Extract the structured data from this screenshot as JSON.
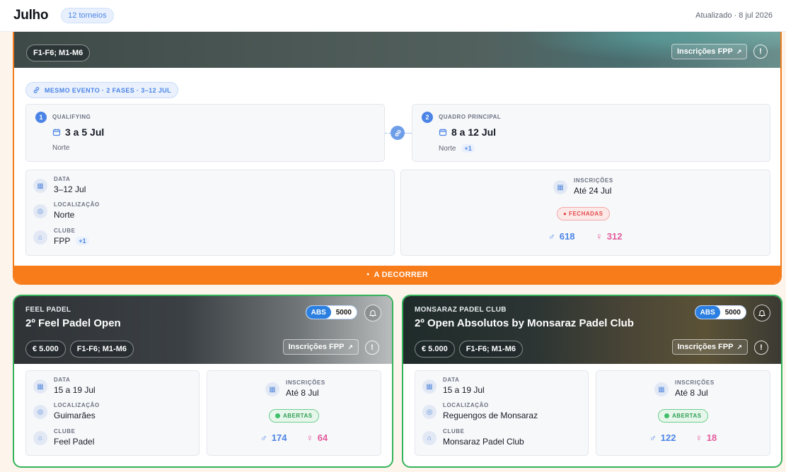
{
  "header": {
    "month": "Julho",
    "tournament_count": "12 torneios",
    "updated": "Atualizado · 8 jul 2026"
  },
  "featured": {
    "category": "F1-F6; M1-M6",
    "fpp_button": "Inscrições FPP",
    "info_icon": "!",
    "event_link": "MESMO EVENTO · 2 FASES · 3–12 JUL",
    "phases": [
      {
        "number": "1",
        "title": "QUALIFYING",
        "date": "3 a 5 Jul",
        "location": "Norte",
        "extra": ""
      },
      {
        "number": "2",
        "title": "QUADRO PRINCIPAL",
        "date": "8 a 12 Jul",
        "location": "Norte",
        "extra": "+1"
      }
    ],
    "details": {
      "date_label": "DATA",
      "date_value": "3–12 Jul",
      "location_label": "LOCALIZAÇÃO",
      "location_value": "Norte",
      "club_label": "CLUBE",
      "club_value": "FPP",
      "club_extra": "+1"
    },
    "registration": {
      "label": "INSCRIÇÕES",
      "value": "Até 24 Jul",
      "status": "FECHADAS",
      "male_count": "618",
      "female_count": "312"
    },
    "footer_status": "A DECORRER"
  },
  "cards": [
    {
      "club": "FEEL PADEL",
      "title": "2º Feel Padel Open",
      "level": "ABS",
      "points": "5000",
      "prize": "€ 5.000",
      "category": "F1-F6; M1-M6",
      "fpp_button": "Inscrições FPP",
      "info_icon": "!",
      "date_label": "DATA",
      "date_value": "15 a 19 Jul",
      "location_label": "LOCALIZAÇÃO",
      "location_value": "Guimarães",
      "club_label": "CLUBE",
      "club_value": "Feel Padel",
      "reg_label": "INSCRIÇÕES",
      "reg_value": "Até 8 Jul",
      "status": "ABERTAS",
      "male_count": "174",
      "female_count": "64"
    },
    {
      "club": "MONSARAZ PADEL CLUB",
      "title": "2º Open Absolutos by Monsaraz Padel Club",
      "level": "ABS",
      "points": "5000",
      "prize": "€ 5.000",
      "category": "F1-F6; M1-M6",
      "fpp_button": "Inscrições FPP",
      "info_icon": "!",
      "date_label": "DATA",
      "date_value": "15 a 19 Jul",
      "location_label": "LOCALIZAÇÃO",
      "location_value": "Reguengos de Monsaraz",
      "club_label": "CLUBE",
      "club_value": "Monsaraz Padel Club",
      "reg_label": "INSCRIÇÕES",
      "reg_value": "Até 8 Jul",
      "status": "ABERTAS",
      "male_count": "122",
      "female_count": "18"
    }
  ],
  "colors": {
    "accent_orange": "#f97c1a",
    "accent_green": "#34b35a",
    "accent_blue": "#4b84e6",
    "female_pink": "#e45c9d",
    "closed_red": "#e24b4b"
  },
  "icons": {
    "calendar": "calendar-icon",
    "location": "location-pin-icon",
    "club": "building-icon",
    "link": "link-icon",
    "bell": "bell-icon",
    "male": "male-icon",
    "female": "female-icon",
    "external": "external-link-icon"
  }
}
